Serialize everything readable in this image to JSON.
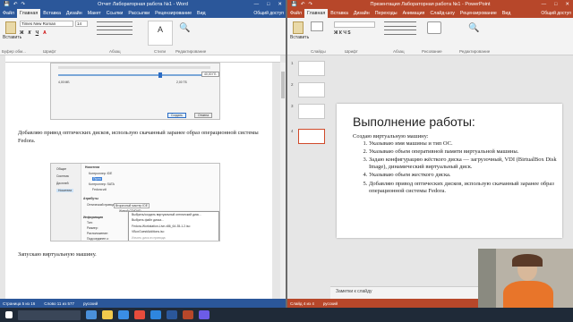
{
  "word": {
    "title": "Отчет Лабораторная работа №1 - Word",
    "tabs": [
      "Файл",
      "Главная",
      "Вставка",
      "Дизайн",
      "Макет",
      "Ссылки",
      "Рассылки",
      "Рецензирование",
      "Вид"
    ],
    "active_tab": "Главная",
    "shared": "Общий доступ",
    "clipboard": {
      "paste": "Вставить",
      "group": "Буфер обм..."
    },
    "font": {
      "name": "Times New Roman",
      "size": "14",
      "group": "Шрифт"
    },
    "groups": {
      "paragraph": "Абзац",
      "styles": "Стили",
      "editing": "Редактирование"
    },
    "doc": {
      "paragraph1": "Добавляю привод оптических дисков, использую скачанный заранее образ операционной системы Fedora.",
      "paragraph2": "Запускаю виртуальную машину.",
      "shot1": {
        "val1": "4,00 МБ",
        "val2": "2,00 ТБ",
        "field": "40,00 ГБ",
        "create": "Создать",
        "cancel": "Отмена"
      },
      "shot2": {
        "media_title": "Носители",
        "left_items": [
          "Общие",
          "Система",
          "Дисплей",
          "Носители"
        ],
        "storage": [
          "Контроллер: IDE",
          "Пусто",
          "Контроллер: SATA",
          "Fedora.vdi"
        ],
        "attrs_title": "Атрибуты",
        "optical_drive": "Оптический привод:",
        "drive_value": "Вторичный мастер IDE",
        "live": "Живой CD/DVD",
        "info_title": "Информация",
        "info_rows": [
          "Тип:",
          "Размер:",
          "Расположение:",
          "Подсоединен к:"
        ],
        "menu": [
          "Выбрать/создать виртуальный оптический диск...",
          "Выбрать файл диска...",
          "Fedora-Workstation-Live-x86_64-35-1.2.iso",
          "VBoxGuestAdditions.iso",
          "Изъять диск из привода"
        ]
      }
    },
    "status": {
      "page": "Страница 5 из 16",
      "words": "Слово 11 из 577",
      "lang": "русский"
    }
  },
  "ppt": {
    "title": "Презентация Лабораторная работа №1 - PowerPoint",
    "tabs": [
      "Файл",
      "Главная",
      "Вставка",
      "Дизайн",
      "Переходы",
      "Анимация",
      "Слайд-шоу",
      "Рецензирование",
      "Вид"
    ],
    "active_tab": "Главная",
    "shared": "Общий доступ",
    "groups": {
      "paste": "Вставить",
      "slides": "Слайды",
      "font": "Шрифт",
      "paragraph": "Абзац",
      "drawing": "Рисование",
      "editing": "Редактирование"
    },
    "thumb_numbers": [
      "1",
      "2",
      "3",
      "4"
    ],
    "selected_slide": "4",
    "slide": {
      "title": "Выполнение работы:",
      "intro": "Создаю виртуальную машину:",
      "items": [
        "Указываю имя машины и тип ОС.",
        "Указываю объем оперативной памяти виртуальной машины.",
        "Задаю конфигурацию жёсткого диска — загрузочный, VDI (BirtualBox Disk Image), динамический виртуальный диск.",
        "Указываю объем жесткого диска.",
        "Добавляю привод оптических дисков, использую скачанный заранее образ операционной системы Fedora."
      ]
    },
    "notes": "Заметки к слайду",
    "status": {
      "slide": "Слайд 4 из 4",
      "lang": "русский"
    }
  },
  "colors": {
    "word_blue": "#2b579a",
    "ppt_red": "#b7472a",
    "taskbar": "#1f2a38"
  }
}
